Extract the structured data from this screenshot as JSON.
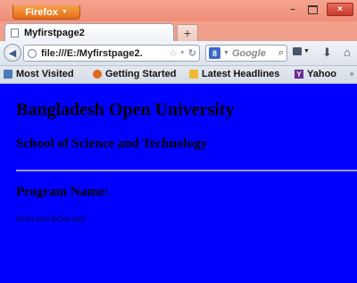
{
  "window": {
    "app_button": "Firefox",
    "minimize": "–",
    "close": "×"
  },
  "tabs": [
    {
      "label": "Myfirstpage2"
    }
  ],
  "new_tab": "+",
  "toolbar": {
    "url": "file:///E:/Myfirstpage2.",
    "search_placeholder": "Google"
  },
  "bookmarks": [
    {
      "label": "Most Visited",
      "icon": "bookmarks-icon"
    },
    {
      "label": "Getting Started",
      "icon": "firefox-icon"
    },
    {
      "label": "Latest Headlines",
      "icon": "rss-icon"
    },
    {
      "label": "Yahoo",
      "icon": "yahoo-icon"
    }
  ],
  "page": {
    "heading": "Bangladesh Open University",
    "subheading": "School of Science and Technology",
    "section_heading": "Program Name:",
    "program_codes": "DCSA 3301 DCSA 3302"
  },
  "colors": {
    "page_background": "#0000ff",
    "titlebar": "#ee8d78",
    "firefox_button": "#e86c15"
  }
}
